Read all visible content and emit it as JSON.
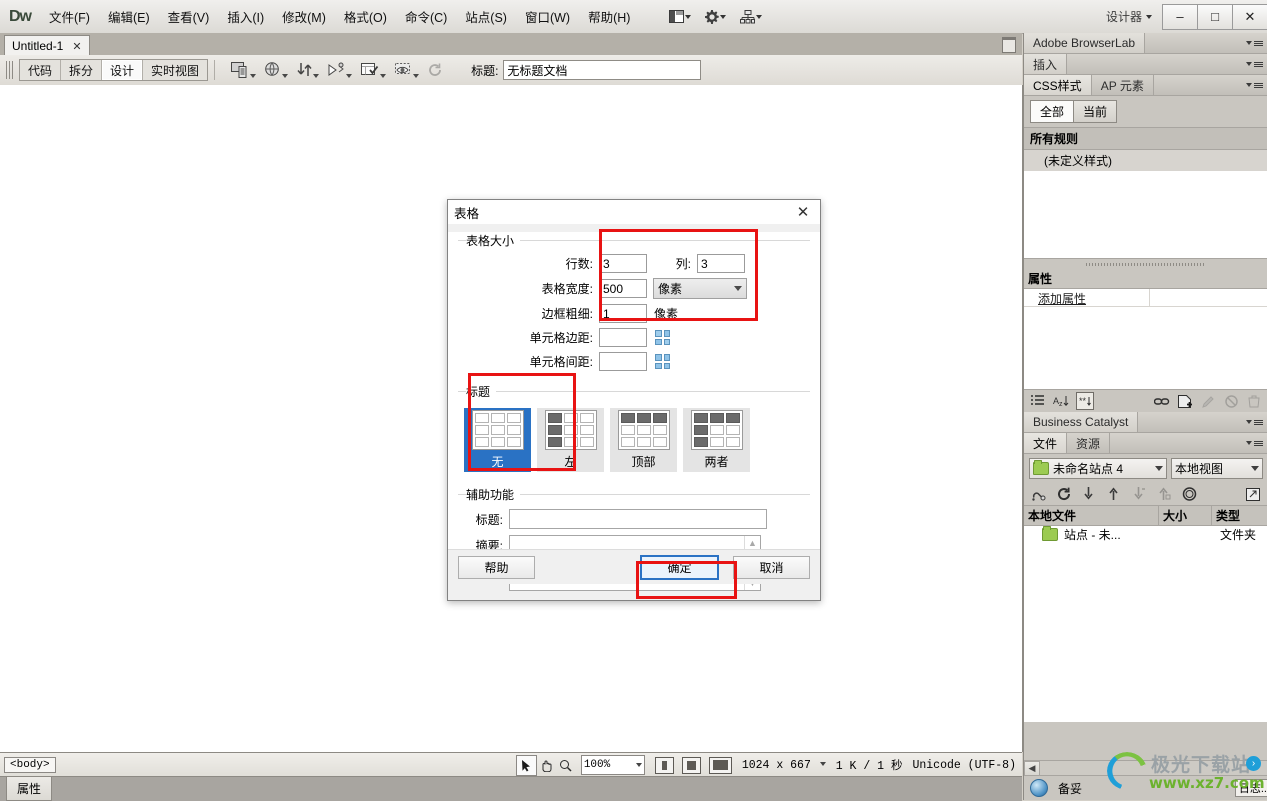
{
  "titlebar": {
    "logo": "Dw",
    "menus": [
      "文件(F)",
      "编辑(E)",
      "查看(V)",
      "插入(I)",
      "修改(M)",
      "格式(O)",
      "命令(C)",
      "站点(S)",
      "窗口(W)",
      "帮助(H)"
    ],
    "icons": [
      "layout-icon",
      "gear-icon",
      "site-tree-icon"
    ],
    "workspace_label": "设计器",
    "window_buttons": {
      "minimize": "–",
      "maximize": "□",
      "close": "✕"
    }
  },
  "document": {
    "tab_label": "Untitled-1",
    "tab_close": "✕",
    "view_buttons": [
      "代码",
      "拆分",
      "设计",
      "实时视图"
    ],
    "active_view": "设计",
    "toolbar_icons": [
      "preview-device-icon",
      "preview-browser-icon",
      "file-transfer-icon",
      "check-in-out-icon",
      "validate-icon",
      "visual-aids-icon",
      "refresh-icon"
    ],
    "title_label": "标题:",
    "title_value": "无标题文档"
  },
  "statusbar": {
    "tag_selector": "<body>",
    "tools": [
      "select-tool",
      "hand-tool",
      "zoom-tool"
    ],
    "zoom_value": "100%",
    "window_sizes": [
      "mobile-size-icon",
      "tablet-size-icon",
      "desktop-size-icon"
    ],
    "dimensions": "1024 x 667",
    "download": "1 K / 1 秒",
    "encoding": "Unicode (UTF-8)",
    "properties_tab": "属性"
  },
  "right_panel": {
    "browserlab": {
      "title": "Adobe BrowserLab"
    },
    "insert": {
      "title": "插入"
    },
    "css": {
      "tabs": [
        {
          "label": "CSS样式",
          "active": true
        },
        {
          "label": "AP 元素",
          "active": false
        }
      ],
      "seg_buttons": [
        {
          "label": "全部",
          "active": true
        },
        {
          "label": "当前",
          "active": false
        }
      ],
      "list_header": "所有规则",
      "rule_row": "(未定义样式)"
    },
    "properties": {
      "title": "属性",
      "add_property": "添加属性",
      "tools": [
        "category-view-icon",
        "az-sort-icon",
        "set-properties-icon",
        "attach-stylesheet-icon",
        "new-rule-icon",
        "edit-rule-icon",
        "disable-property-icon",
        "delete-property-icon"
      ]
    },
    "business_catalyst": {
      "title": "Business Catalyst"
    },
    "files": {
      "tabs": [
        {
          "label": "文件",
          "active": true
        },
        {
          "label": "资源",
          "active": false
        }
      ],
      "site_combo": "未命名站点 4",
      "view_combo": "本地视图",
      "tools": [
        "connect-icon",
        "refresh-icon",
        "get-files-icon",
        "put-files-icon",
        "check-out-icon",
        "check-in-icon",
        "synchronize-icon",
        "expand-icon"
      ],
      "columns": [
        "本地文件",
        "大小",
        "类型"
      ],
      "rows": [
        {
          "name": "站点 - 未...",
          "size": "",
          "type": "文件夹",
          "icon": "folder-icon"
        }
      ]
    },
    "status": {
      "label": "备妥",
      "log": "日志..."
    }
  },
  "dialog": {
    "title": "表格",
    "close": "✕",
    "groups": {
      "table_size": {
        "label": "表格大小",
        "rows_label": "行数:",
        "rows_value": "3",
        "cols_label": "列:",
        "cols_value": "3",
        "width_label": "表格宽度:",
        "width_value": "500",
        "width_unit": "像素",
        "border_label": "边框粗细:",
        "border_value": "1",
        "border_unit": "像素",
        "cellpad_label": "单元格边距:",
        "cellpad_value": "",
        "cellspace_label": "单元格间距:",
        "cellspace_value": ""
      },
      "header": {
        "label": "标题",
        "options": [
          {
            "label": "无",
            "selected": true,
            "pattern": "none"
          },
          {
            "label": "左",
            "selected": false,
            "pattern": "left"
          },
          {
            "label": "顶部",
            "selected": false,
            "pattern": "top"
          },
          {
            "label": "两者",
            "selected": false,
            "pattern": "both"
          }
        ]
      },
      "accessibility": {
        "label": "辅助功能",
        "caption_label": "标题:",
        "caption_value": "",
        "summary_label": "摘要:",
        "summary_value": ""
      }
    },
    "buttons": {
      "help": "帮助",
      "ok": "确定",
      "cancel": "取消"
    }
  },
  "watermark": {
    "line1": "极光下载站",
    "line2": "www.xz7.com"
  },
  "colors": {
    "accent_blue": "#2a72c4",
    "annotation_red": "#e81313",
    "panel_bg": "#c9c6c0",
    "titlebar_bg": "#e6e4e0"
  }
}
